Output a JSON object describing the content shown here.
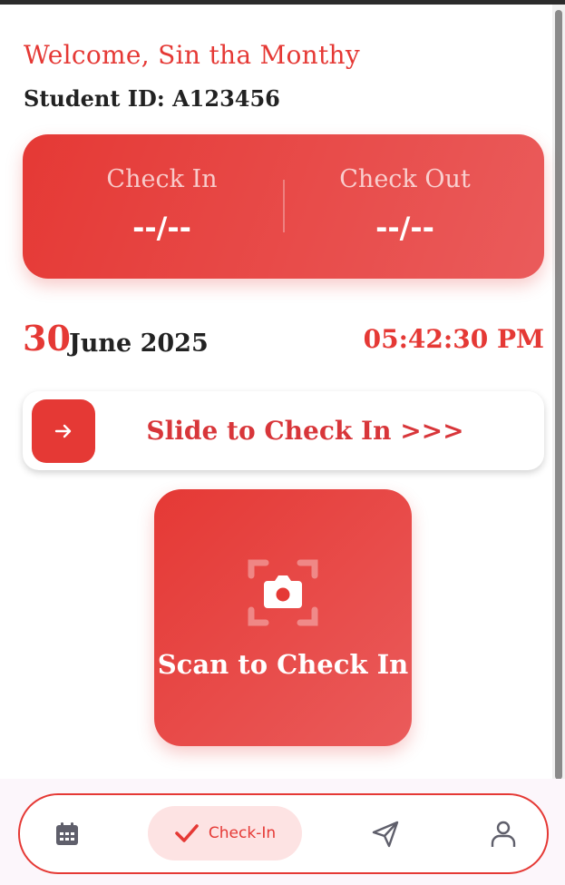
{
  "greeting": "Welcome, Sin tha Monthy",
  "student_id": "Student ID: A123456",
  "status": {
    "check_in_label": "Check In",
    "check_in_value": "--/--",
    "check_out_label": "Check Out",
    "check_out_value": "--/--"
  },
  "date": {
    "day": "30",
    "month_year": "June 2025",
    "time": "05:42:30 PM"
  },
  "slider": {
    "label": "Slide to Check In >>>",
    "knob_icon": "arrow-right-icon"
  },
  "scan": {
    "label": "Scan to Check In",
    "icon": "camera-scan-icon"
  },
  "nav": {
    "items": [
      {
        "icon": "calendar-icon"
      },
      {
        "icon": "check-icon",
        "label": "Check-In",
        "active": true
      },
      {
        "icon": "send-icon"
      },
      {
        "icon": "user-icon"
      }
    ]
  },
  "colors": {
    "accent": "#e53935",
    "accent_light": "#fde3e3",
    "nav_icon": "#5f5f6b"
  }
}
